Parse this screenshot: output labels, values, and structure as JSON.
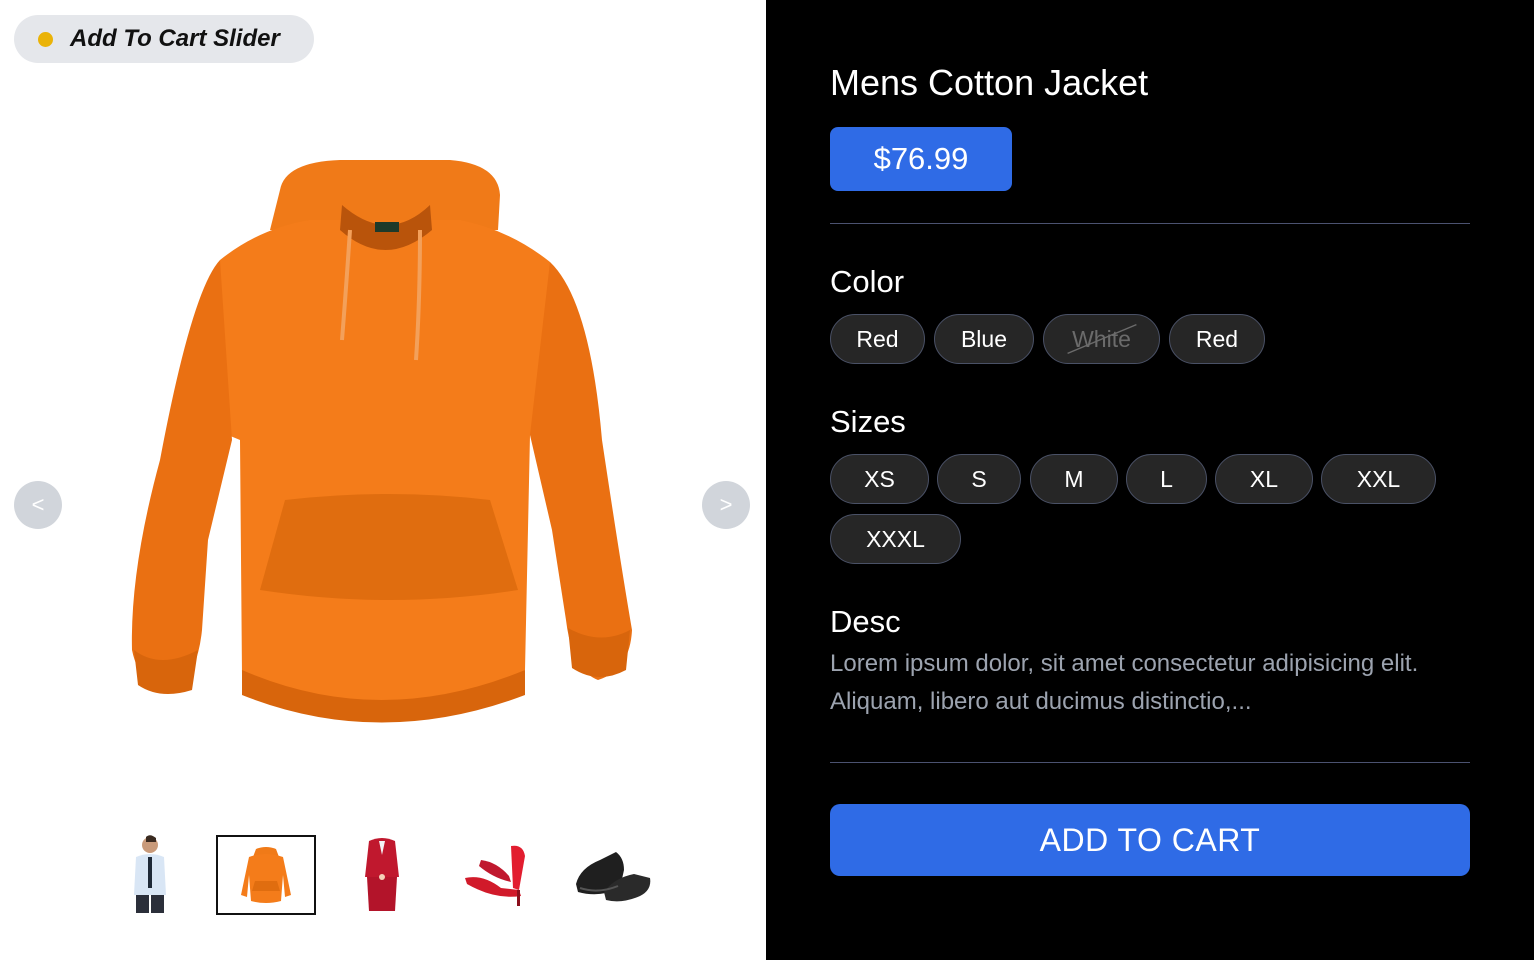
{
  "badge": {
    "label": "Add To Cart Slider",
    "dot_color": "#eab308"
  },
  "carousel": {
    "prev_label": "<",
    "next_label": ">",
    "main_image": "orange-hoodie",
    "thumbnails": [
      {
        "name": "man-in-shirt-thumbnail",
        "selected": false
      },
      {
        "name": "orange-hoodie-thumbnail",
        "selected": true
      },
      {
        "name": "red-suit-thumbnail",
        "selected": false
      },
      {
        "name": "red-heels-thumbnail",
        "selected": false
      },
      {
        "name": "black-shoes-thumbnail",
        "selected": false
      }
    ]
  },
  "product": {
    "title": "Mens Cotton Jacket",
    "price": "$76.99",
    "color_label": "Color",
    "colors": [
      {
        "label": "Red",
        "available": true
      },
      {
        "label": "Blue",
        "available": true
      },
      {
        "label": "White",
        "available": false
      },
      {
        "label": "Red",
        "available": true
      }
    ],
    "sizes_label": "Sizes",
    "sizes": [
      "XS",
      "S",
      "M",
      "L",
      "XL",
      "XXL",
      "XXXL"
    ],
    "desc_label": "Desc",
    "description": "Lorem ipsum dolor, sit amet consectetur adipisicing elit. Aliquam, libero aut ducimus distinctio,...",
    "add_to_cart_label": "ADD TO CART"
  },
  "colors": {
    "accent": "#2f6be6",
    "panel_bg": "#000000",
    "chip_bg": "#262626"
  }
}
